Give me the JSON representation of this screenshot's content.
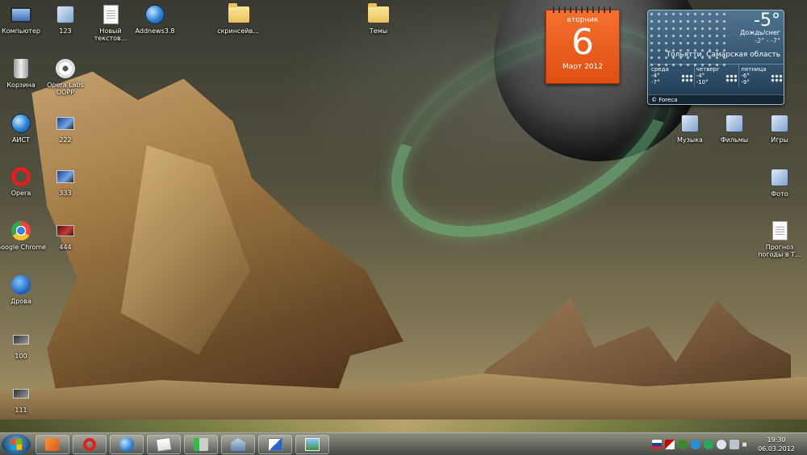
{
  "desktop": {
    "icons": {
      "computer": "Компьютер",
      "i123": "123",
      "new_text": "Новый текстов...",
      "addnews": "Addnews3.8",
      "screens": "скринсейв...",
      "themes": "Темы",
      "recycle": "Корзина",
      "operalabs": "Opera Labs OOPP",
      "aist": "АИСТ",
      "i222": "222",
      "opera": "Opera",
      "i333": "333",
      "chrome": "Google Chrome",
      "i444": "444",
      "drivers": "Дрова",
      "i100": "100",
      "i111": "111",
      "music": "Музыка",
      "films": "Фильмы",
      "games": "Игры",
      "photo": "Фото",
      "forecast": "Прогноз погоды в Т..."
    }
  },
  "calendar": {
    "weekday": "вторник",
    "day": "6",
    "month_year": "Март 2012"
  },
  "weather": {
    "temp": "-5°",
    "condition": "Дождь/снег",
    "range": "-2° - -7°",
    "location": "Тольятти, Самарская область",
    "forecast": [
      {
        "day": "среда",
        "high": "-4°",
        "low": "-7°"
      },
      {
        "day": "четверг",
        "high": "-4°",
        "low": "-10°"
      },
      {
        "day": "пятница",
        "high": "-6°",
        "low": "-9°"
      }
    ],
    "provider": "© Foreca"
  },
  "taskbar": {
    "clock_time": "19:30",
    "clock_date": "06.03.2012",
    "pinned": [
      "mail-icon",
      "opera-icon",
      "browser-globe-icon",
      "notes-icon",
      "tools-icon",
      "bank-icon",
      "paint-icon",
      "photo-viewer-icon"
    ]
  }
}
